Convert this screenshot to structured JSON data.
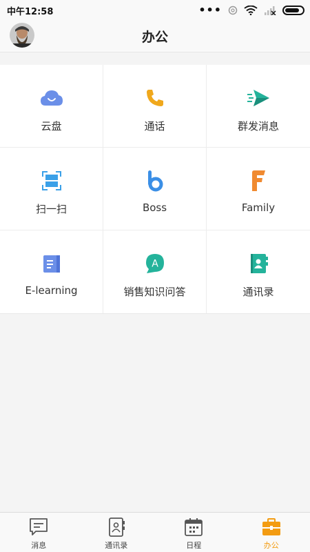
{
  "status": {
    "time": "中午12:58"
  },
  "header": {
    "title": "办公"
  },
  "grid": [
    {
      "label": "云盘",
      "icon": "cloud-icon",
      "color": "#6b8fe8"
    },
    {
      "label": "通话",
      "icon": "phone-icon",
      "color": "#f0a81c"
    },
    {
      "label": "群发消息",
      "icon": "send-icon",
      "color": "#24b39b"
    },
    {
      "label": "扫一扫",
      "icon": "scan-icon",
      "color": "#3aa0e8"
    },
    {
      "label": "Boss",
      "icon": "boss-logo-icon",
      "color": "#3b8fe6"
    },
    {
      "label": "Family",
      "icon": "family-logo-icon",
      "color": "#f08a30"
    },
    {
      "label": "E-learning",
      "icon": "book-icon",
      "color": "#6b8fe8"
    },
    {
      "label": "销售知识问答",
      "icon": "qa-bubble-icon",
      "color": "#24b39b"
    },
    {
      "label": "通讯录",
      "icon": "contacts-book-icon",
      "color": "#24b39b"
    }
  ],
  "tabs": [
    {
      "label": "消息",
      "icon": "message-icon"
    },
    {
      "label": "通讯录",
      "icon": "contacts-icon"
    },
    {
      "label": "日程",
      "icon": "calendar-icon"
    },
    {
      "label": "办公",
      "icon": "briefcase-icon",
      "active": true,
      "color": "#f39c12"
    }
  ]
}
